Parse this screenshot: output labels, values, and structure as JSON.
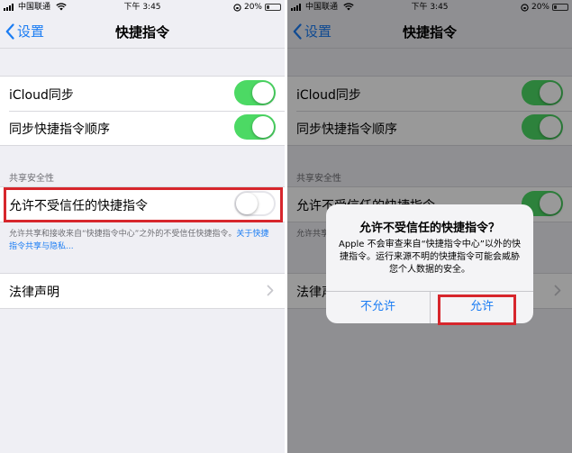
{
  "status_bar": {
    "carrier": "中国联通",
    "time": "下午 3:45",
    "battery": "20%",
    "battery_level": 0.2
  },
  "nav": {
    "back_label": "设置",
    "title": "快捷指令"
  },
  "settings": {
    "icloud_sync": {
      "label": "iCloud同步",
      "on": true
    },
    "sync_order": {
      "label": "同步快捷指令顺序",
      "on": true
    },
    "sharing_security_header": "共享安全性",
    "allow_untrusted": {
      "label": "允许不受信任的快捷指令",
      "on_left": false,
      "on_right": true
    },
    "footer_text": "允许共享和接收来自“快捷指令中心”之外的不受信任快捷指令。",
    "footer_link": "关于快捷指令共享与隐私...",
    "legal": {
      "label": "法律声明",
      "partial_label": "法律声"
    }
  },
  "alert": {
    "title": "允许不受信任的快捷指令？",
    "message": "Apple 不会审查来自“快捷指令中心”以外的快捷指令。运行来源不明的快捷指令可能会威胁您个人数据的安全。",
    "deny_label": "不允许",
    "allow_label": "允许"
  },
  "colors": {
    "accent": "#1a7cf3",
    "toggle_on": "#4cd964",
    "highlight": "#d7262c"
  }
}
